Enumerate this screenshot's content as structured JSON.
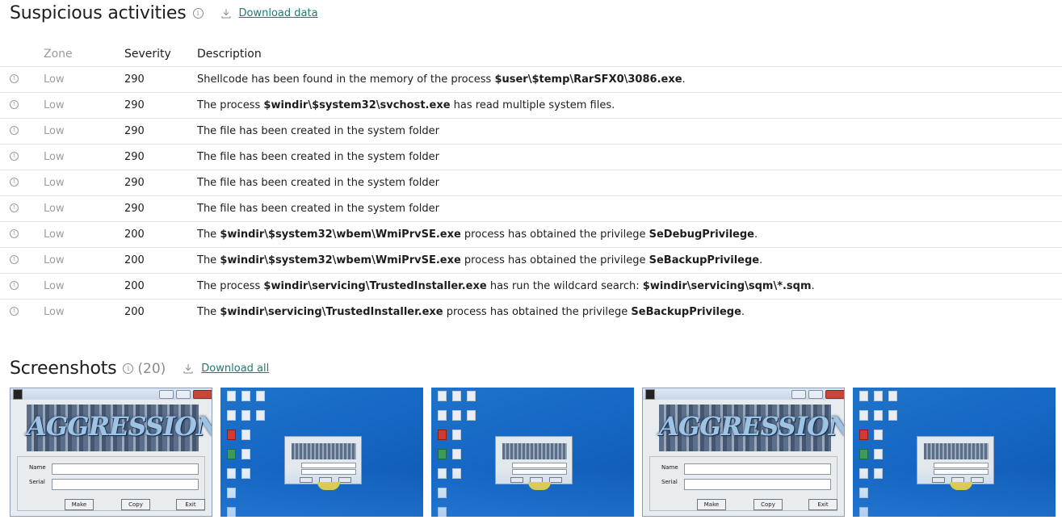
{
  "suspicious": {
    "title": "Suspicious activities",
    "info_glyph": "i",
    "download_label": "Download data",
    "columns": {
      "zone": "Zone",
      "severity": "Severity",
      "description": "Description"
    },
    "rows": [
      {
        "zone": "Low",
        "severity": "290",
        "d": [
          "Shellcode has been found in the memory of the process ",
          "$user\\$temp\\RarSFX0\\3086.exe",
          ".",
          "",
          ""
        ]
      },
      {
        "zone": "Low",
        "severity": "290",
        "d": [
          "The process ",
          "$windir\\$system32\\svchost.exe",
          " has read multiple system files.",
          "",
          ""
        ]
      },
      {
        "zone": "Low",
        "severity": "290",
        "d": [
          "The file has been created in the system folder",
          "",
          "",
          "",
          ""
        ]
      },
      {
        "zone": "Low",
        "severity": "290",
        "d": [
          "The file has been created in the system folder",
          "",
          "",
          "",
          ""
        ]
      },
      {
        "zone": "Low",
        "severity": "290",
        "d": [
          "The file has been created in the system folder",
          "",
          "",
          "",
          ""
        ]
      },
      {
        "zone": "Low",
        "severity": "290",
        "d": [
          "The file has been created in the system folder",
          "",
          "",
          "",
          ""
        ]
      },
      {
        "zone": "Low",
        "severity": "200",
        "d": [
          "The ",
          "$windir\\$system32\\wbem\\WmiPrvSE.exe",
          " process has obtained the privilege ",
          "SeDebugPrivilege",
          "."
        ]
      },
      {
        "zone": "Low",
        "severity": "200",
        "d": [
          "The ",
          "$windir\\$system32\\wbem\\WmiPrvSE.exe",
          " process has obtained the privilege ",
          "SeBackupPrivilege",
          "."
        ]
      },
      {
        "zone": "Low",
        "severity": "200",
        "d": [
          "The process ",
          "$windir\\servicing\\TrustedInstaller.exe",
          " has run the wildcard search: ",
          "$windir\\servicing\\sqm\\*.sqm",
          "."
        ]
      },
      {
        "zone": "Low",
        "severity": "200",
        "d": [
          "The ",
          "$windir\\servicing\\TrustedInstaller.exe",
          " process has obtained the privilege ",
          "SeBackupPrivilege",
          "."
        ]
      }
    ]
  },
  "screenshots": {
    "title": "Screenshots",
    "count": "(20)",
    "download_label": "Download all",
    "dialog": {
      "banner": "AGGRESSION",
      "name_label": "Name",
      "serial_label": "Serial",
      "make_button": "Make",
      "copy_button": "Copy",
      "exit_button": "Exit"
    },
    "thumbnail_kinds": [
      "app-window",
      "desktop",
      "desktop",
      "app-window",
      "desktop"
    ]
  },
  "icons": {
    "info": "info-circle-icon",
    "download": "download-icon",
    "row_status": "clock-icon"
  },
  "colors": {
    "link": "#1c7b74",
    "zone_text": "#9b9b9b",
    "desktop_blue": "#1669c4"
  }
}
